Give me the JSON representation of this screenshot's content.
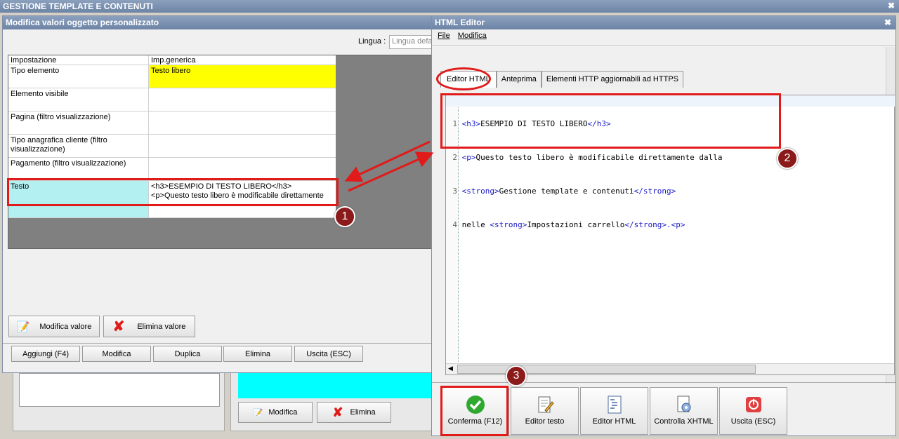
{
  "app": {
    "title": "GESTIONE TEMPLATE E CONTENUTI"
  },
  "left_window": {
    "title": "Modifica valori oggetto personalizzato",
    "lingua_label": "Lingua :",
    "lingua_value": "Lingua defa",
    "columns": [
      "Impostazione",
      "Imp.generica"
    ],
    "rows": [
      {
        "setting": "Tipo elemento",
        "value": "Testo libero"
      },
      {
        "setting": "Elemento visibile",
        "value": ""
      },
      {
        "setting": "Pagina (filtro visualizzazione)",
        "value": ""
      },
      {
        "setting": "Tipo anagrafica cliente (filtro visualizzazione)",
        "value": ""
      },
      {
        "setting": "Pagamento (filtro visualizzazione)",
        "value": ""
      },
      {
        "setting": "Testo",
        "value_line1": "<h3>ESEMPIO DI TESTO LIBERO</h3>",
        "value_line2": "<p>Questo testo libero è modificabile direttamente"
      }
    ],
    "modifica_valore": "Modifica valore",
    "elimina_valore": "Elimina valore",
    "bottom_buttons": [
      "Aggiungi (F4)",
      "Modifica",
      "Duplica",
      "Elimina",
      "Uscita (ESC)"
    ]
  },
  "background": {
    "modifica": "Modifica",
    "elimina": "Elimina"
  },
  "editor": {
    "title": "HTML Editor",
    "menu": [
      "File",
      "Modifica"
    ],
    "tabs": [
      "Editor HTML",
      "Anteprima",
      "Elementi HTTP aggiornabili ad HTTPS"
    ],
    "lines": [
      {
        "n": "1",
        "a": "<h3>",
        "b": "ESEMPIO DI TESTO LIBERO",
        "c": "</h3>",
        "d": "",
        "e": ""
      },
      {
        "n": "2",
        "a": "<p>",
        "b": "Questo testo libero è modificabile direttamente dalla",
        "c": "",
        "d": "",
        "e": ""
      },
      {
        "n": "3",
        "a": "<strong>",
        "b": "Gestione template e contenuti",
        "c": "</strong>",
        "d": "",
        "e": ""
      },
      {
        "n": "4",
        "a": "",
        "b": "nelle ",
        "c": "<strong>",
        "d": "Impostazioni carrello",
        "e": "</strong>.<p>"
      }
    ],
    "buttons": [
      "Conferma (F12)",
      "Editor testo",
      "Editor HTML",
      "Controlla XHTML",
      "Uscita (ESC)"
    ]
  },
  "badges": [
    "1",
    "2",
    "3"
  ],
  "colors": {
    "highlight_yellow": "#ffff00",
    "highlight_cyan": "#b2f0f2",
    "annotation_red": "#e11a1a",
    "badge": "#8b1a1a"
  }
}
